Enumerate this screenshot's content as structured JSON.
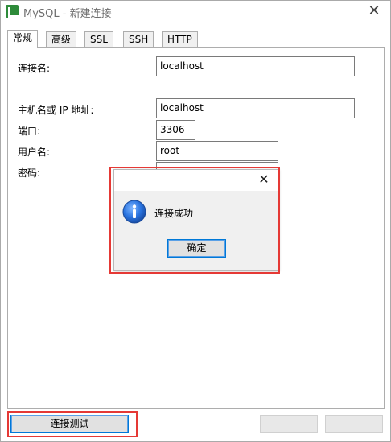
{
  "window": {
    "title": "MySQL - 新建连接"
  },
  "tabs": [
    {
      "label": "常规",
      "active": true
    },
    {
      "label": "高级",
      "active": false
    },
    {
      "label": "SSL",
      "active": false
    },
    {
      "label": "SSH",
      "active": false
    },
    {
      "label": "HTTP",
      "active": false
    }
  ],
  "form": {
    "connection_name": {
      "label": "连接名:",
      "value": "localhost"
    },
    "host": {
      "label": "主机名或 IP 地址:",
      "value": "localhost"
    },
    "port": {
      "label": "端口:",
      "value": "3306"
    },
    "username": {
      "label": "用户名:",
      "value": "root"
    },
    "password": {
      "label": "密码:",
      "value": ""
    }
  },
  "buttons": {
    "test_connection": "连接测试"
  },
  "dialog": {
    "message": "连接成功",
    "ok_label": "确定"
  },
  "colors": {
    "highlight": "#e53935",
    "focus_border": "#0078d7",
    "logo": "#2e8b3a",
    "info_icon": "#1e6fd9"
  }
}
